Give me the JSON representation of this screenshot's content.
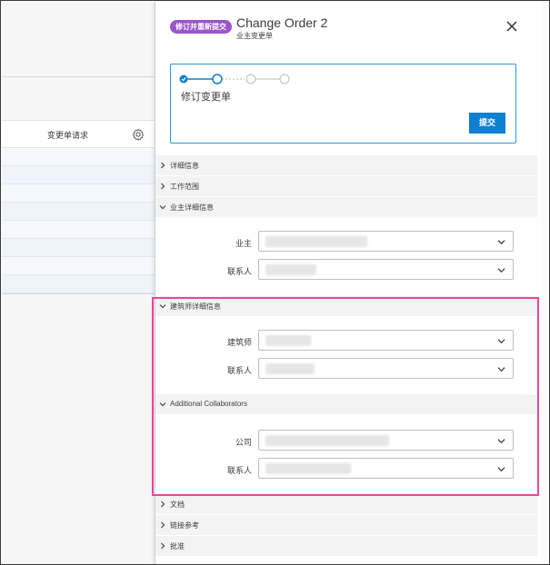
{
  "background": {
    "column_header": "变更单请求"
  },
  "panel": {
    "badge": "修订并重新提交",
    "title": "Change Order 2",
    "subtitle": "业主变更单",
    "stepper": {
      "current_step_label": "修订变更单",
      "submit_label": "提交"
    },
    "sections": {
      "details": "详细信息",
      "scope": "工作范围",
      "owner_details": "业主详细信息",
      "architect_details": "建筑师详细信息",
      "additional_collaborators": "Additional Collaborators",
      "documents": "文档",
      "link_refs": "链接参考",
      "approval": "批准"
    },
    "fields": {
      "owner_label": "业主",
      "owner_contact_label": "联系人",
      "architect_label": "建筑师",
      "architect_contact_label": "联系人",
      "company_label": "公司",
      "collab_contact_label": "联系人"
    }
  },
  "colors": {
    "badge": "#9a55c9",
    "accent_blue": "#0e7fd1",
    "highlight_pink": "#e8469a"
  }
}
